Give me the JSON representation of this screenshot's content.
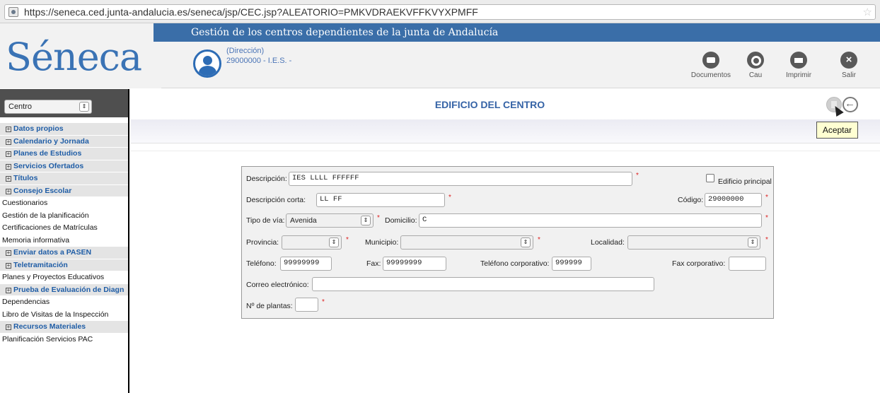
{
  "browser": {
    "url": "https://seneca.ced.junta-andalucia.es/seneca/jsp/CEC.jsp?ALEATORIO=PMKVDRAEKVFFKVYXPMFF"
  },
  "header": {
    "logo_text": "Séneca",
    "banner": "Gestión de los centros dependientes de la junta de Andalucía",
    "user_role": "(Dirección)",
    "user_center": "29000000 - I.E.S. -",
    "tools": {
      "documentos": "Documentos",
      "cau": "Cau",
      "imprimir": "Imprimir",
      "salir": "Salir"
    }
  },
  "sidebar": {
    "select_value": "Centro",
    "items": [
      {
        "label": "Datos propios",
        "type": "section"
      },
      {
        "label": "Calendario y Jornada",
        "type": "section"
      },
      {
        "label": "Planes de Estudios",
        "type": "section"
      },
      {
        "label": "Servicios Ofertados",
        "type": "section"
      },
      {
        "label": "Títulos",
        "type": "section"
      },
      {
        "label": "Consejo Escolar",
        "type": "section"
      },
      {
        "label": "Cuestionarios",
        "type": "leaf"
      },
      {
        "label": "Gestión de la planificación",
        "type": "leaf"
      },
      {
        "label": "Certificaciones de Matrículas",
        "type": "leaf"
      },
      {
        "label": "Memoria informativa",
        "type": "leaf"
      },
      {
        "label": "Enviar datos a PASEN",
        "type": "section"
      },
      {
        "label": "Teletramitación",
        "type": "section"
      },
      {
        "label": "Planes y Proyectos Educativos",
        "type": "leaf"
      },
      {
        "label": "Prueba de Evaluación de Diagn",
        "type": "section"
      },
      {
        "label": "Dependencias",
        "type": "leaf"
      },
      {
        "label": "Libro de Visitas de la Inspección",
        "type": "leaf"
      },
      {
        "label": "Recursos Materiales",
        "type": "section"
      },
      {
        "label": "Planificación Servicios PAC",
        "type": "leaf"
      }
    ]
  },
  "main": {
    "title": "EDIFICIO DEL CENTRO",
    "tooltip": "Aceptar"
  },
  "form": {
    "descripcion_label": "Descripción:",
    "descripcion_value": "IES LLLL  FFFFFF",
    "edificio_principal_label": "Edificio principal",
    "edificio_principal_checked": false,
    "descripcion_corta_label": "Descripción corta:",
    "descripcion_corta_value": "LL  FF",
    "codigo_label": "Código:",
    "codigo_value": "29000000",
    "tipo_via_label": "Tipo de vía:",
    "tipo_via_value": "Avenida",
    "domicilio_label": "Domicilio:",
    "domicilio_value": "C",
    "provincia_label": "Provincia:",
    "provincia_value": "",
    "municipio_label": "Municipio:",
    "municipio_value": "",
    "localidad_label": "Localidad:",
    "localidad_value": "",
    "telefono_label": "Teléfono:",
    "telefono_value": "99999999",
    "fax_label": "Fax:",
    "fax_value": "99999999",
    "telefono_corp_label": "Teléfono corporativo:",
    "telefono_corp_value": "999999",
    "fax_corp_label": "Fax corporativo:",
    "fax_corp_value": "",
    "correo_label": "Correo electrónico:",
    "correo_value": "",
    "plantas_label": "Nº de plantas:",
    "plantas_value": "",
    "required_mark": "*"
  }
}
